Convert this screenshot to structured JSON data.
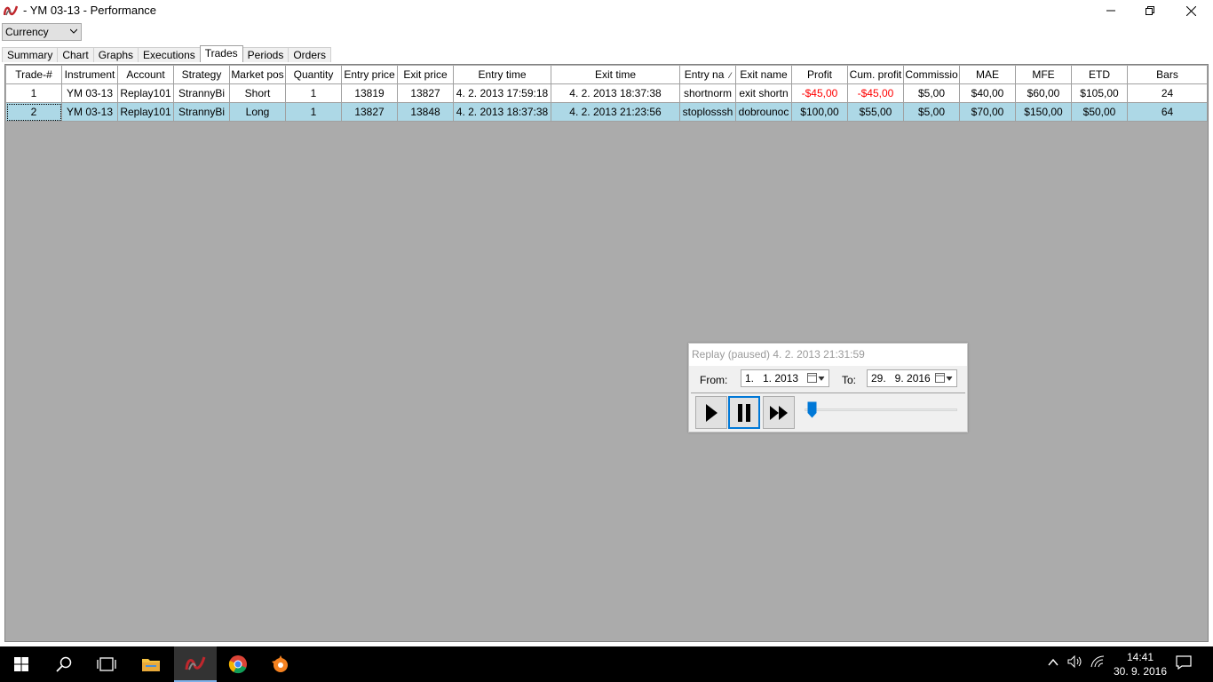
{
  "window": {
    "title": " - YM 03-13 - Performance"
  },
  "controls": {
    "min": "—",
    "max": "❐",
    "close": "✕"
  },
  "currency": {
    "value": "Currency"
  },
  "tabs": [
    "Summary",
    "Chart",
    "Graphs",
    "Executions",
    "Trades",
    "Periods",
    "Orders"
  ],
  "active_tab": "Trades",
  "table": {
    "headers": [
      "Trade-#",
      "Instrument",
      "Account",
      "Strategy",
      "Market pos",
      "Quantity",
      "Entry price",
      "Exit price",
      "Entry time",
      "Exit time",
      "Entry na",
      "Exit name",
      "Profit",
      "Cum. profit",
      "Commissio",
      "MAE",
      "MFE",
      "ETD",
      "Bars"
    ],
    "rows": [
      [
        "1",
        "YM 03-13",
        "Replay101",
        "StrannyBi",
        "Short",
        "1",
        "13819",
        "13827",
        "4. 2. 2013 17:59:18",
        "4. 2. 2013 18:37:38",
        "shortnorm",
        "exit shortn",
        "-$45,00",
        "-$45,00",
        "$5,00",
        "$40,00",
        "$60,00",
        "$105,00",
        "24"
      ],
      [
        "2",
        "YM 03-13",
        "Replay101",
        "StrannyBi",
        "Long",
        "1",
        "13827",
        "13848",
        "4. 2. 2013 18:37:38",
        "4. 2. 2013 21:23:56",
        "stoplosssh",
        "dobrounoc",
        "$100,00",
        "$55,00",
        "$5,00",
        "$70,00",
        "$150,00",
        "$50,00",
        "64"
      ]
    ],
    "selected_row": 1,
    "sort_indicator": "⁄"
  },
  "replay": {
    "title": "Replay (paused) 4. 2. 2013 21:31:59",
    "from_label": "From:",
    "from_value": "1.   1. 2013",
    "to_label": "To:",
    "to_value": "29.   9. 2016",
    "progress": 0.0
  },
  "taskbar": {
    "time": "14:41",
    "date": "30. 9. 2016",
    "icons": [
      "windows-start-icon",
      "search-icon",
      "task-view-icon",
      "file-explorer-icon",
      "ninjatrader-icon",
      "chrome-icon",
      "avast-icon"
    ]
  },
  "colors": {
    "selected_row": "#add8e6",
    "negative": "#ff0000",
    "grid_bg": "#ababab",
    "accent": "#0078d7"
  }
}
